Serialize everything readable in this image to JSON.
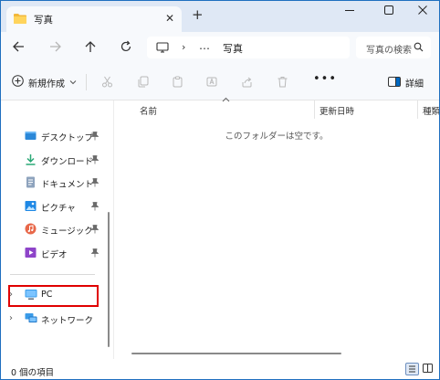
{
  "tab": {
    "title": "写真"
  },
  "address": {
    "crumb": "写真",
    "overflow": "…",
    "separator": "›"
  },
  "search": {
    "placeholder": "写真の検索"
  },
  "toolbar": {
    "new_label": "新規作成",
    "more_label": "•••",
    "details_label": "詳細"
  },
  "nav": {
    "items": [
      {
        "label": "デスクトップ",
        "icon": "desktop-icon",
        "pinned": true
      },
      {
        "label": "ダウンロード",
        "icon": "download-icon",
        "pinned": true
      },
      {
        "label": "ドキュメント",
        "icon": "documents-icon",
        "pinned": true
      },
      {
        "label": "ピクチャ",
        "icon": "pictures-icon",
        "pinned": true
      },
      {
        "label": "ミュージック",
        "icon": "music-icon",
        "pinned": true
      },
      {
        "label": "ビデオ",
        "icon": "videos-icon",
        "pinned": true
      }
    ],
    "pc_label": "PC",
    "network_label": "ネットワーク"
  },
  "columns": {
    "name": "名前",
    "modified": "更新日時",
    "type": "種類"
  },
  "content": {
    "empty_message": "このフォルダーは空です。"
  },
  "status": {
    "item_count": "0 個の項目"
  },
  "colors": {
    "accent": "#0067c0",
    "highlight": "#e00000",
    "chrome": "#dfe8f5"
  }
}
